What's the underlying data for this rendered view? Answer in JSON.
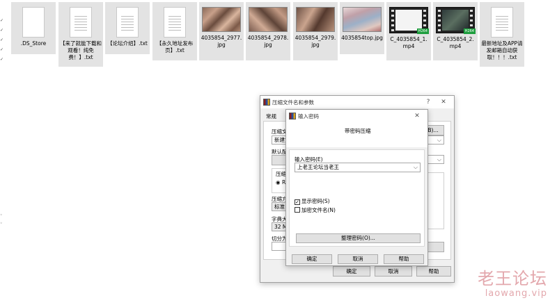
{
  "files": [
    {
      "name": ".DS_Store",
      "kind": "doc"
    },
    {
      "name": "【来了就能下载和观看！纯免费！】.txt",
      "kind": "txt"
    },
    {
      "name": "【论坛介绍】.txt",
      "kind": "txt"
    },
    {
      "name": "【永久地址发布页】.txt",
      "kind": "txt"
    },
    {
      "name": "4035854_2977.jpg",
      "kind": "photo"
    },
    {
      "name": "4035854_2978.jpg",
      "kind": "photo"
    },
    {
      "name": "4035854_2979.jpg",
      "kind": "photo"
    },
    {
      "name": "4035854top.jpg",
      "kind": "photo"
    },
    {
      "name": "C_4035854_1.mp4",
      "kind": "video"
    },
    {
      "name": "C_4035854_2.mp4",
      "kind": "video"
    },
    {
      "name": "最新地址及APP请发邮箱自动获取！！！.txt",
      "kind": "txt"
    }
  ],
  "video_badge": "H264",
  "archive_dialog": {
    "title": "压缩文件名和参数",
    "help_symbol": "?",
    "close_symbol": "✕",
    "tab_general": "常规",
    "label_archive_name": "压缩文",
    "archive_name_value": "新建文",
    "browse_label": "B)...",
    "label_default": "默认配",
    "group_format": "压缩文",
    "radio_rar": "RA",
    "label_method": "压缩方",
    "method_value": "标准",
    "label_dict": "字典大",
    "dict_value": "32 MB",
    "label_split": "切分为",
    "ok": "确定",
    "cancel": "取消",
    "help": "帮助"
  },
  "password_dialog": {
    "title": "输入密码",
    "close_symbol": "✕",
    "heading": "带密码压缩",
    "label_password": "输入密码(E)",
    "password_value": "上老王论坛当老王",
    "show_password": "显示密码(S)",
    "show_password_checked": true,
    "encrypt_names": "加密文件名(N)",
    "encrypt_names_checked": false,
    "organize": "整理密码(O)...",
    "ok": "确定",
    "cancel": "取消",
    "help": "帮助"
  },
  "watermark": {
    "cn": "老王论坛",
    "en": "laowang.vip"
  }
}
